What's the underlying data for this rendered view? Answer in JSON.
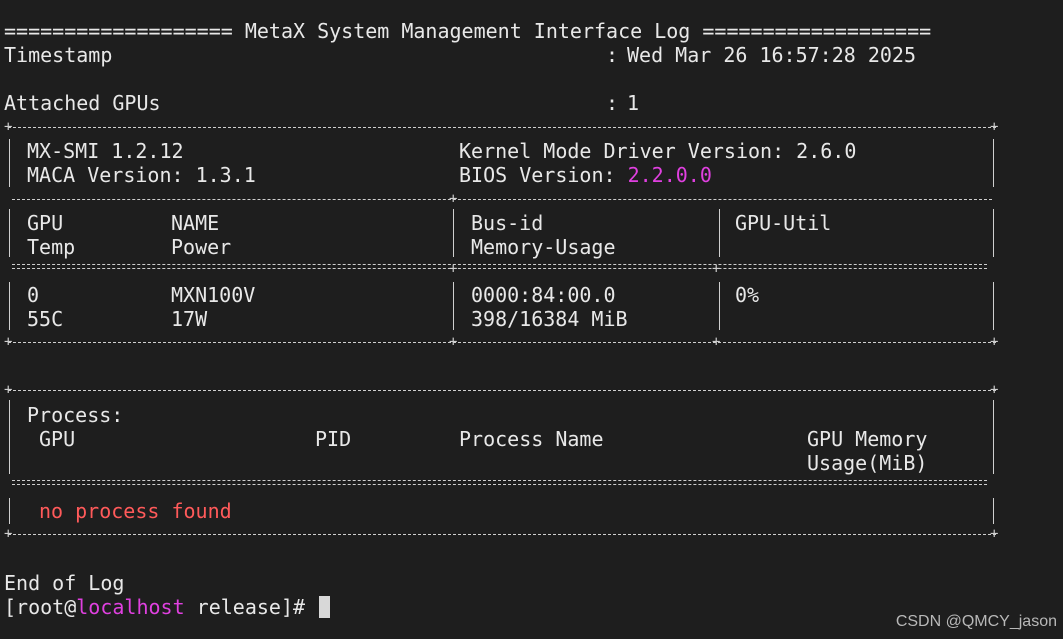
{
  "header": {
    "title_line": "=================== MetaX System Management Interface Log ===================",
    "timestamp_label": "Timestamp",
    "timestamp_sep": ":",
    "timestamp_value": "Wed Mar 26 16:57:28 2025",
    "attached_label": "Attached GPUs",
    "attached_sep": ":",
    "attached_value": "1"
  },
  "gpu_table": {
    "mxsmi": "MX-SMI 1.2.12",
    "kmd": "Kernel Mode Driver Version: 2.6.0",
    "maca": "MACA Version: 1.3.1",
    "bios_label": "BIOS Version: ",
    "bios_value": "2.2.0.0",
    "col_gpu": "GPU",
    "col_temp": "Temp",
    "col_name": "NAME",
    "col_power": "Power",
    "col_busid": "Bus-id",
    "col_mem": "Memory-Usage",
    "col_util": "GPU-Util",
    "row": {
      "gpu": "0",
      "temp": "55C",
      "name": "MXN100V",
      "power": "17W",
      "busid": "0000:84:00.0",
      "mem": "398/16384 MiB",
      "util": "0%"
    }
  },
  "process_table": {
    "title": "Process:",
    "col_gpu": "GPU",
    "col_pid": "PID",
    "col_name": "Process Name",
    "col_mem1": "GPU Memory",
    "col_mem2": "Usage(MiB)",
    "empty": "no process found"
  },
  "footer": {
    "end": "End of Log",
    "prompt_pre": "[root@",
    "prompt_host": "localhost",
    "prompt_post": " release]# "
  },
  "colors": {
    "background": "#1e1e1e",
    "text": "#e8e8e8",
    "host": "#e040e0",
    "bios": "#e040e0",
    "empty_msg": "#ff5a5a"
  },
  "watermark": "CSDN @QMCY_jason"
}
